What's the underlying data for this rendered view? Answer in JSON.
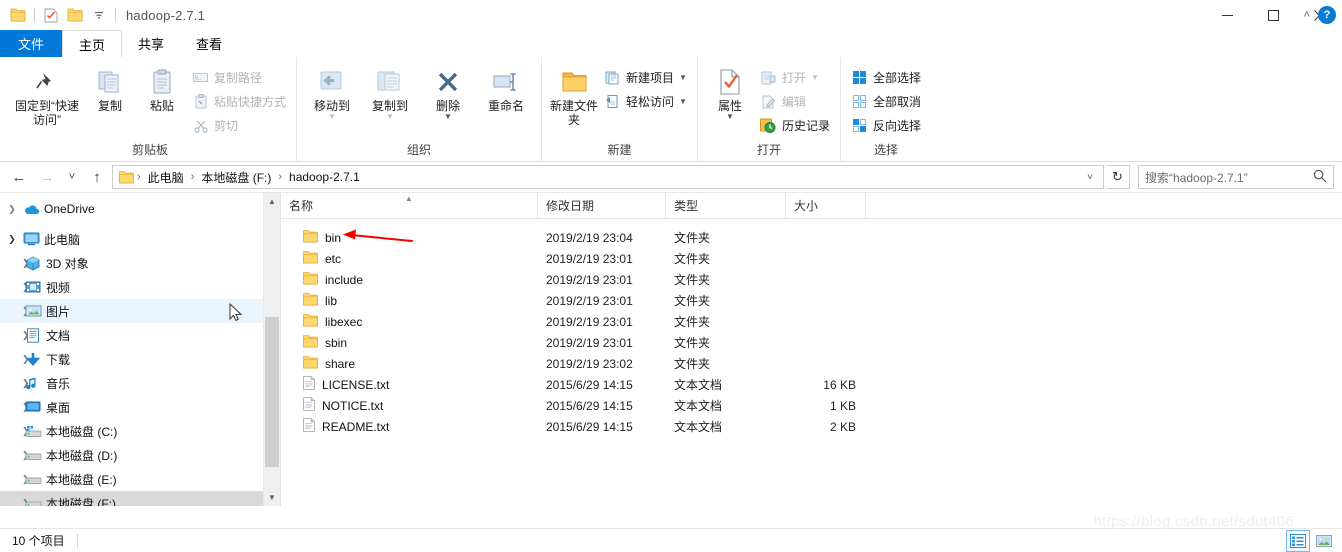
{
  "window": {
    "title": "hadoop-2.7.1",
    "quick_access": [
      {
        "name": "folder-icon",
        "label": ""
      },
      {
        "name": "properties-icon",
        "label": ""
      },
      {
        "name": "new-folder-icon",
        "label": ""
      },
      {
        "name": "chevron-down-icon",
        "label": ""
      }
    ],
    "controls": {
      "minimize": "—",
      "maximize": "☐",
      "close": "✕"
    },
    "collapse_ribbon": "˄",
    "help": "?"
  },
  "tabs": [
    {
      "label": "文件",
      "kind": "file"
    },
    {
      "label": "主页",
      "kind": "active"
    },
    {
      "label": "共享",
      "kind": "normal"
    },
    {
      "label": "查看",
      "kind": "normal"
    }
  ],
  "ribbon": {
    "groups": [
      {
        "label": "剪贴板",
        "big": [
          {
            "label": "固定到“快速访问”",
            "icon": "pin-icon",
            "dim": false
          },
          {
            "label": "复制",
            "icon": "copy-icon",
            "dim": false
          },
          {
            "label": "粘贴",
            "icon": "paste-icon",
            "dim": false
          }
        ],
        "small": [
          {
            "label": "复制路径",
            "icon": "copy-path-icon",
            "dim": true
          },
          {
            "label": "粘贴快捷方式",
            "icon": "paste-shortcut-icon",
            "dim": true
          },
          {
            "label": "剪切",
            "icon": "scissors-icon",
            "dim": true
          }
        ]
      },
      {
        "label": "组织",
        "big": [
          {
            "label": "移动到",
            "icon": "move-to-icon",
            "dim": true
          },
          {
            "label": "复制到",
            "icon": "copy-to-icon",
            "dim": true
          },
          {
            "label": "删除",
            "icon": "delete-icon",
            "dim": false
          },
          {
            "label": "重命名",
            "icon": "rename-icon",
            "dim": true
          }
        ],
        "small": []
      },
      {
        "label": "新建",
        "big": [
          {
            "label": "新建文件夹",
            "icon": "new-folder-icon",
            "dim": false
          }
        ],
        "small": [
          {
            "label": "新建项目",
            "icon": "new-item-icon",
            "dim": false,
            "caret": true
          },
          {
            "label": "轻松访问",
            "icon": "easy-access-icon",
            "dim": false,
            "caret": true
          }
        ]
      },
      {
        "label": "打开",
        "big": [
          {
            "label": "属性",
            "icon": "properties-icon",
            "dim": false
          }
        ],
        "small": [
          {
            "label": "打开",
            "icon": "open-icon",
            "dim": true,
            "caret": true
          },
          {
            "label": "编辑",
            "icon": "edit-icon",
            "dim": true
          },
          {
            "label": "历史记录",
            "icon": "history-icon",
            "dim": false
          }
        ]
      },
      {
        "label": "选择",
        "big": [],
        "small": [
          {
            "label": "全部选择",
            "icon": "select-all-icon",
            "dim": false
          },
          {
            "label": "全部取消",
            "icon": "select-none-icon",
            "dim": false
          },
          {
            "label": "反向选择",
            "icon": "invert-selection-icon",
            "dim": false
          }
        ]
      }
    ]
  },
  "addressbar": {
    "back": "←",
    "forward": "→",
    "recent": "˅",
    "up": "↑",
    "breadcrumbs": [
      "此电脑",
      "本地磁盘 (F:)",
      "hadoop-2.7.1"
    ],
    "dropdown": "˅",
    "refresh": "↻",
    "search_placeholder": "搜索“hadoop-2.7.1”",
    "search_value": ""
  },
  "tree": {
    "items": [
      {
        "label": "OneDrive",
        "icon": "onedrive-icon",
        "indent": 0,
        "expander": "collapsed",
        "state": "normal"
      },
      {
        "label": "此电脑",
        "icon": "this-pc-icon",
        "indent": 0,
        "expander": "expanded",
        "state": "normal"
      },
      {
        "label": "3D 对象",
        "icon": "3d-objects-icon",
        "indent": 1,
        "expander": "collapsed",
        "state": "normal"
      },
      {
        "label": "视频",
        "icon": "videos-icon",
        "indent": 1,
        "expander": "collapsed",
        "state": "normal"
      },
      {
        "label": "图片",
        "icon": "pictures-icon",
        "indent": 1,
        "expander": "collapsed",
        "state": "hover"
      },
      {
        "label": "文档",
        "icon": "documents-icon",
        "indent": 1,
        "expander": "collapsed",
        "state": "normal"
      },
      {
        "label": "下载",
        "icon": "downloads-icon",
        "indent": 1,
        "expander": "collapsed",
        "state": "normal"
      },
      {
        "label": "音乐",
        "icon": "music-icon",
        "indent": 1,
        "expander": "collapsed",
        "state": "normal"
      },
      {
        "label": "桌面",
        "icon": "desktop-icon",
        "indent": 1,
        "expander": "collapsed",
        "state": "normal"
      },
      {
        "label": "本地磁盘 (C:)",
        "icon": "system-drive-icon",
        "indent": 1,
        "expander": "collapsed",
        "state": "normal"
      },
      {
        "label": "本地磁盘 (D:)",
        "icon": "drive-icon",
        "indent": 1,
        "expander": "collapsed",
        "state": "normal"
      },
      {
        "label": "本地磁盘 (E:)",
        "icon": "drive-icon",
        "indent": 1,
        "expander": "collapsed",
        "state": "normal"
      },
      {
        "label": "本地磁盘 (F:)",
        "icon": "drive-icon",
        "indent": 1,
        "expander": "collapsed",
        "state": "selected"
      }
    ]
  },
  "filelist": {
    "columns": [
      {
        "key": "name",
        "label": "名称",
        "sorted": true
      },
      {
        "key": "date",
        "label": "修改日期",
        "sorted": false
      },
      {
        "key": "type",
        "label": "类型",
        "sorted": false
      },
      {
        "key": "size",
        "label": "大小",
        "sorted": false
      }
    ],
    "rows": [
      {
        "name": "bin",
        "date": "2019/2/19 23:04",
        "type": "文件夹",
        "size": "",
        "icon": "folder-icon",
        "annotated": true
      },
      {
        "name": "etc",
        "date": "2019/2/19 23:01",
        "type": "文件夹",
        "size": "",
        "icon": "folder-icon",
        "annotated": false
      },
      {
        "name": "include",
        "date": "2019/2/19 23:01",
        "type": "文件夹",
        "size": "",
        "icon": "folder-icon",
        "annotated": false
      },
      {
        "name": "lib",
        "date": "2019/2/19 23:01",
        "type": "文件夹",
        "size": "",
        "icon": "folder-icon",
        "annotated": false
      },
      {
        "name": "libexec",
        "date": "2019/2/19 23:01",
        "type": "文件夹",
        "size": "",
        "icon": "folder-icon",
        "annotated": false
      },
      {
        "name": "sbin",
        "date": "2019/2/19 23:01",
        "type": "文件夹",
        "size": "",
        "icon": "folder-icon",
        "annotated": false
      },
      {
        "name": "share",
        "date": "2019/2/19 23:02",
        "type": "文件夹",
        "size": "",
        "icon": "folder-icon",
        "annotated": false
      },
      {
        "name": "LICENSE.txt",
        "date": "2015/6/29 14:15",
        "type": "文本文档",
        "size": "16 KB",
        "icon": "text-file-icon",
        "annotated": false
      },
      {
        "name": "NOTICE.txt",
        "date": "2015/6/29 14:15",
        "type": "文本文档",
        "size": "1 KB",
        "icon": "text-file-icon",
        "annotated": false
      },
      {
        "name": "README.txt",
        "date": "2015/6/29 14:15",
        "type": "文本文档",
        "size": "2 KB",
        "icon": "text-file-icon",
        "annotated": false
      }
    ]
  },
  "statusbar": {
    "item_count": "10 个项目",
    "views": [
      {
        "name": "details-view-button",
        "selected": true
      },
      {
        "name": "large-icons-view-button",
        "selected": false
      }
    ]
  },
  "watermark": "https://blog.csdn.net/sdut406",
  "colors": {
    "accent": "#0078d7",
    "folder": "#ffd766",
    "selection": "#cce8ff",
    "annotation_arrow": "#ff0000"
  }
}
